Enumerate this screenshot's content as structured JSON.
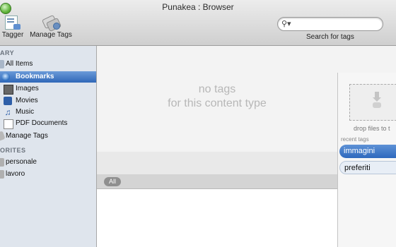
{
  "window": {
    "title": "Punakea : Browser"
  },
  "toolbar": {
    "tagger_label": "Tagger",
    "manage_tags_label": "Manage Tags",
    "search_placeholder": "",
    "search_caption": "Search for tags"
  },
  "sidebar": {
    "library_header": "ARY",
    "items": [
      {
        "label": "All Items",
        "icon": "all-items-icon",
        "selected": false
      },
      {
        "label": "Bookmarks",
        "icon": "bookmarks-icon",
        "selected": true
      },
      {
        "label": "Images",
        "icon": "images-icon",
        "selected": false
      },
      {
        "label": "Movies",
        "icon": "movies-icon",
        "selected": false
      },
      {
        "label": "Music",
        "icon": "music-icon",
        "selected": false
      },
      {
        "label": "PDF Documents",
        "icon": "pdf-icon",
        "selected": false
      },
      {
        "label": "Manage Tags",
        "icon": "manage-tags-icon",
        "selected": false
      }
    ],
    "favorites_header": "ORITES",
    "favorites": [
      {
        "label": "personale"
      },
      {
        "label": "lavoro"
      }
    ]
  },
  "main": {
    "empty_line1": "no tags",
    "empty_line2": "for this content type",
    "filter_pill": "All"
  },
  "tag_panel": {
    "drop_caption": "drop files to t",
    "recent_label": "recent tags",
    "recent_tags": [
      {
        "label": "immagini",
        "selected": true
      },
      {
        "label": "preferiti",
        "selected": false
      }
    ]
  },
  "colors": {
    "selection": "#2f67b8",
    "sidebar_bg": "#dfe5ed",
    "accent_green": "#5fb43a"
  }
}
